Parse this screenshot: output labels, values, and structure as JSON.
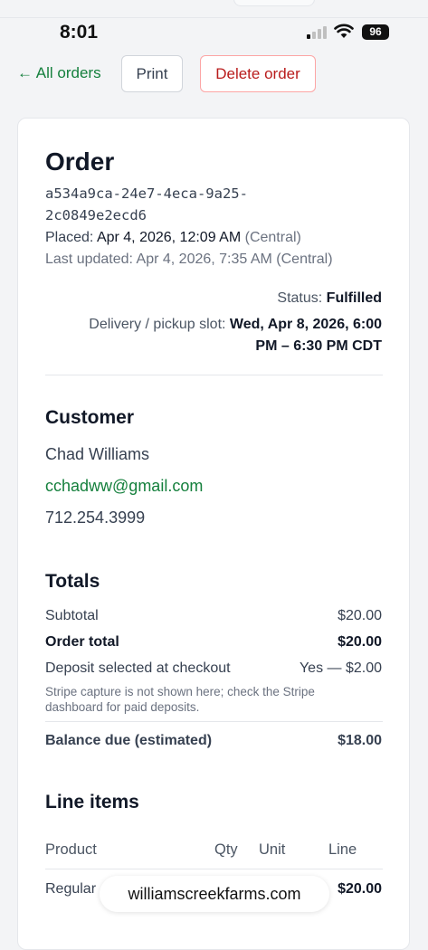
{
  "status_bar": {
    "time": "8:01",
    "battery": "96"
  },
  "toolbar": {
    "back_label": "← All orders",
    "print_label": "Print",
    "delete_label": "Delete order"
  },
  "order": {
    "title": "Order",
    "id_line1": "a534a9ca-24e7-4eca-9a25-",
    "id_line2": "2c0849e2ecd6",
    "placed_label": "Placed:",
    "placed_value": "Apr 4, 2026, 12:09 AM",
    "placed_tz": "(Central)",
    "updated_text": "Last updated: Apr 4, 2026, 7:35 AM (Central)",
    "status_label": "Status:",
    "status_value": "Fulfilled",
    "slot_label": "Delivery / pickup slot:",
    "slot_value_line1": "Wed, Apr 8, 2026, 6:00",
    "slot_value_line2": "PM – 6:30 PM CDT"
  },
  "customer": {
    "heading": "Customer",
    "name": "Chad Williams",
    "email": "cchadww@gmail.com",
    "phone": "712.254.3999"
  },
  "totals": {
    "heading": "Totals",
    "subtotal_label": "Subtotal",
    "subtotal_value": "$20.00",
    "order_total_label": "Order total",
    "order_total_value": "$20.00",
    "deposit_label": "Deposit selected at checkout",
    "deposit_value": "Yes — $2.00",
    "note": "Stripe capture is not shown here; check the Stripe dashboard for paid deposits.",
    "balance_label": "Balance due (estimated)",
    "balance_value": "$18.00"
  },
  "line_items": {
    "heading": "Line items",
    "columns": [
      "Product",
      "Qty",
      "Unit",
      "Line"
    ],
    "rows": [
      {
        "product": "Regular",
        "line": "$20.00"
      }
    ]
  },
  "browser": {
    "url": "williamscreekfarms.com"
  }
}
